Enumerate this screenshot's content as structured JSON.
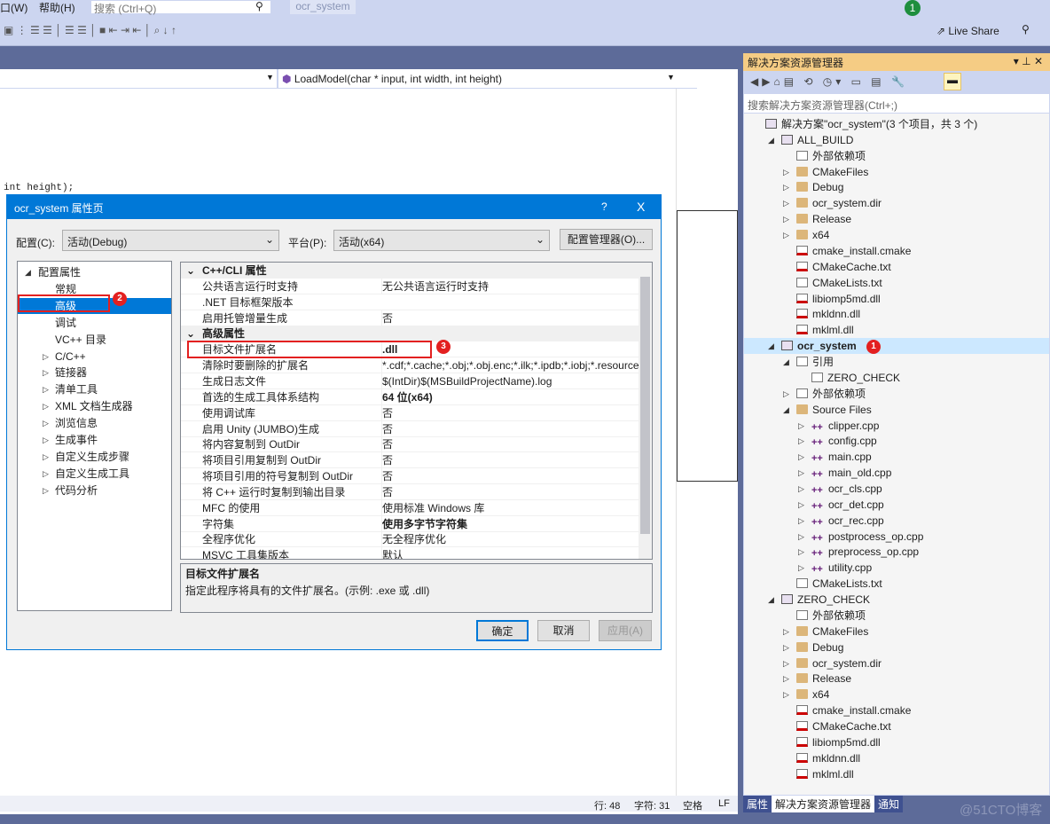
{
  "menubar": {
    "items": [
      "口(W)",
      "帮助(H)"
    ],
    "search_placeholder": "搜索 (Ctrl+Q)",
    "project_title": "ocr_system",
    "notification_count": "1",
    "live_share": "Live Share"
  },
  "editor": {
    "nav_function": "LoadModel(char * input, int width, int height)",
    "code_fragment": "int height);",
    "status": {
      "line": "行: 48",
      "char": "字符: 31",
      "indent": "空格",
      "eol": "LF"
    }
  },
  "dialog": {
    "title": "ocr_system 属性页",
    "help": "?",
    "close": "X",
    "config_label": "配置(C):",
    "config_value": "活动(Debug)",
    "platform_label": "平台(P):",
    "platform_value": "活动(x64)",
    "config_manager": "配置管理器(O)...",
    "tree": [
      {
        "label": "配置属性",
        "level": 0,
        "arrow": "◢"
      },
      {
        "label": "常规",
        "level": 1
      },
      {
        "label": "高级",
        "level": 1,
        "selected": true
      },
      {
        "label": "调试",
        "level": 1
      },
      {
        "label": "VC++ 目录",
        "level": 1
      },
      {
        "label": "C/C++",
        "level": 1,
        "arrow": "▷"
      },
      {
        "label": "链接器",
        "level": 1,
        "arrow": "▷"
      },
      {
        "label": "清单工具",
        "level": 1,
        "arrow": "▷"
      },
      {
        "label": "XML 文档生成器",
        "level": 1,
        "arrow": "▷"
      },
      {
        "label": "浏览信息",
        "level": 1,
        "arrow": "▷"
      },
      {
        "label": "生成事件",
        "level": 1,
        "arrow": "▷"
      },
      {
        "label": "自定义生成步骤",
        "level": 1,
        "arrow": "▷"
      },
      {
        "label": "自定义生成工具",
        "level": 1,
        "arrow": "▷"
      },
      {
        "label": "代码分析",
        "level": 1,
        "arrow": "▷"
      }
    ],
    "properties": [
      {
        "section": "C++/CLI 属性"
      },
      {
        "k": "公共语言运行时支持",
        "v": "无公共语言运行时支持"
      },
      {
        "k": ".NET 目标框架版本",
        "v": ""
      },
      {
        "k": "启用托管增量生成",
        "v": "否"
      },
      {
        "section": "高级属性"
      },
      {
        "k": "目标文件扩展名",
        "v": ".dll",
        "bold": true,
        "highlight": true
      },
      {
        "k": "清除时要删除的扩展名",
        "v": "*.cdf;*.cache;*.obj;*.obj.enc;*.ilk;*.ipdb;*.iobj;*.resource"
      },
      {
        "k": "生成日志文件",
        "v": "$(IntDir)$(MSBuildProjectName).log"
      },
      {
        "k": "首选的生成工具体系结构",
        "v": "64 位(x64)",
        "bold": true
      },
      {
        "k": "使用调试库",
        "v": "否"
      },
      {
        "k": "启用 Unity (JUMBO)生成",
        "v": "否"
      },
      {
        "k": "将内容复制到 OutDir",
        "v": "否"
      },
      {
        "k": "将项目引用复制到 OutDir",
        "v": "否"
      },
      {
        "k": "将项目引用的符号复制到 OutDir",
        "v": "否"
      },
      {
        "k": "将 C++ 运行时复制到输出目录",
        "v": "否"
      },
      {
        "k": "MFC 的使用",
        "v": "使用标准 Windows 库"
      },
      {
        "k": "字符集",
        "v": "使用多字节字符集",
        "bold": true
      },
      {
        "k": "全程序优化",
        "v": "无全程序优化"
      },
      {
        "k": "MSVC 工具集版本",
        "v": "默认"
      }
    ],
    "description_title": "目标文件扩展名",
    "description_text": "指定此程序将具有的文件扩展名。(示例: .exe 或 .dll)",
    "ok": "确定",
    "cancel": "取消",
    "apply": "应用(A)"
  },
  "annotations": [
    "1",
    "2",
    "3"
  ],
  "solution_explorer": {
    "title": "解决方案资源管理器",
    "search_placeholder": "搜索解决方案资源管理器(Ctrl+;)",
    "items": [
      {
        "label": "解决方案\"ocr_system\"(3 个项目，共 3 个)",
        "indent": 0,
        "icon": "solution"
      },
      {
        "label": "ALL_BUILD",
        "indent": 1,
        "icon": "project",
        "arrow": "◢"
      },
      {
        "label": "外部依赖项",
        "indent": 2,
        "icon": "deps"
      },
      {
        "label": "CMakeFiles",
        "indent": 2,
        "icon": "folder",
        "arrow": "▷"
      },
      {
        "label": "Debug",
        "indent": 2,
        "icon": "folder",
        "arrow": "▷"
      },
      {
        "label": "ocr_system.dir",
        "indent": 2,
        "icon": "folder",
        "arrow": "▷"
      },
      {
        "label": "Release",
        "indent": 2,
        "icon": "folder",
        "arrow": "▷"
      },
      {
        "label": "x64",
        "indent": 2,
        "icon": "folder",
        "arrow": "▷"
      },
      {
        "label": "cmake_install.cmake",
        "indent": 2,
        "icon": "dll"
      },
      {
        "label": "CMakeCache.txt",
        "indent": 2,
        "icon": "dll"
      },
      {
        "label": "CMakeLists.txt",
        "indent": 2,
        "icon": "file"
      },
      {
        "label": "libiomp5md.dll",
        "indent": 2,
        "icon": "dll"
      },
      {
        "label": "mkldnn.dll",
        "indent": 2,
        "icon": "dll"
      },
      {
        "label": "mklml.dll",
        "indent": 2,
        "icon": "dll"
      },
      {
        "label": "ocr_system",
        "indent": 1,
        "icon": "project",
        "arrow": "◢",
        "bold": true,
        "highlight": true
      },
      {
        "label": "引用",
        "indent": 2,
        "icon": "ref",
        "arrow": "◢"
      },
      {
        "label": "ZERO_CHECK",
        "indent": 3,
        "icon": "ref"
      },
      {
        "label": "外部依赖项",
        "indent": 2,
        "icon": "deps",
        "arrow": "▷"
      },
      {
        "label": "Source Files",
        "indent": 2,
        "icon": "folder",
        "arrow": "◢"
      },
      {
        "label": "clipper.cpp",
        "indent": 3,
        "icon": "cpp",
        "arrow": "▷"
      },
      {
        "label": "config.cpp",
        "indent": 3,
        "icon": "cpp",
        "arrow": "▷"
      },
      {
        "label": "main.cpp",
        "indent": 3,
        "icon": "cpp",
        "arrow": "▷"
      },
      {
        "label": "main_old.cpp",
        "indent": 3,
        "icon": "cpp",
        "arrow": "▷"
      },
      {
        "label": "ocr_cls.cpp",
        "indent": 3,
        "icon": "cpp",
        "arrow": "▷"
      },
      {
        "label": "ocr_det.cpp",
        "indent": 3,
        "icon": "cpp",
        "arrow": "▷"
      },
      {
        "label": "ocr_rec.cpp",
        "indent": 3,
        "icon": "cpp",
        "arrow": "▷"
      },
      {
        "label": "postprocess_op.cpp",
        "indent": 3,
        "icon": "cpp",
        "arrow": "▷"
      },
      {
        "label": "preprocess_op.cpp",
        "indent": 3,
        "icon": "cpp",
        "arrow": "▷"
      },
      {
        "label": "utility.cpp",
        "indent": 3,
        "icon": "cpp",
        "arrow": "▷"
      },
      {
        "label": "CMakeLists.txt",
        "indent": 2,
        "icon": "file"
      },
      {
        "label": "ZERO_CHECK",
        "indent": 1,
        "icon": "project",
        "arrow": "◢"
      },
      {
        "label": "外部依赖项",
        "indent": 2,
        "icon": "deps"
      },
      {
        "label": "CMakeFiles",
        "indent": 2,
        "icon": "folder",
        "arrow": "▷"
      },
      {
        "label": "Debug",
        "indent": 2,
        "icon": "folder",
        "arrow": "▷"
      },
      {
        "label": "ocr_system.dir",
        "indent": 2,
        "icon": "folder",
        "arrow": "▷"
      },
      {
        "label": "Release",
        "indent": 2,
        "icon": "folder",
        "arrow": "▷"
      },
      {
        "label": "x64",
        "indent": 2,
        "icon": "folder",
        "arrow": "▷"
      },
      {
        "label": "cmake_install.cmake",
        "indent": 2,
        "icon": "dll"
      },
      {
        "label": "CMakeCache.txt",
        "indent": 2,
        "icon": "dll"
      },
      {
        "label": "libiomp5md.dll",
        "indent": 2,
        "icon": "dll"
      },
      {
        "label": "mkldnn.dll",
        "indent": 2,
        "icon": "dll"
      },
      {
        "label": "mklml.dll",
        "indent": 2,
        "icon": "dll"
      }
    ],
    "tabs": [
      "属性",
      "解决方案资源管理器",
      "通知"
    ],
    "active_tab": "解决方案资源管理器"
  },
  "watermark": "@51CTO博客",
  "colors": {
    "accent": "#0078d7",
    "annotation": "#e32020",
    "vs_frame": "#5d6b99"
  }
}
